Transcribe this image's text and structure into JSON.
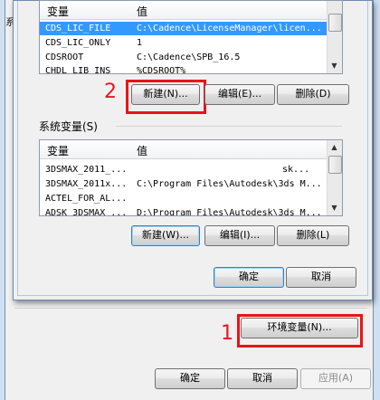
{
  "parent_window": {
    "tab_fragment": "系",
    "env_vars_button": "环境变量(N)...",
    "ok_button": "确定",
    "cancel_button": "取消",
    "apply_button": "应用(A)"
  },
  "user_vars": {
    "header": {
      "name_col": "变量",
      "value_col": "值"
    },
    "rows": [
      {
        "name": "CDS_LIC_FILE",
        "value": "C:\\Cadence\\LicenseManager\\licen...",
        "selected": true
      },
      {
        "name": "CDS_LIC_ONLY",
        "value": "1",
        "selected": false
      },
      {
        "name": "CDSROOT",
        "value": "C:\\Cadence\\SPB_16.5",
        "selected": false
      },
      {
        "name": "CHDL_LIB_INS",
        "value": "%CDSROOT%",
        "selected": false
      }
    ],
    "buttons": {
      "new": "新建(N)...",
      "edit": "编辑(E)...",
      "delete": "删除(D)"
    }
  },
  "system_vars": {
    "label": "系统变量(S)",
    "header": {
      "name_col": "变量",
      "value_col": "值"
    },
    "rows": [
      {
        "name": "3DSMAX_2011_...",
        "value": "sk..."
      },
      {
        "name": "3DSMAX_2011x...",
        "value": "C:\\Program Files\\Autodesk\\3ds M..."
      },
      {
        "name": "ACTEL_FOR_AL...",
        "value": ""
      },
      {
        "name": "ADSK_3DSMAX_...",
        "value": "D:\\Program Files\\Autodesk\\3ds M..."
      }
    ],
    "buttons": {
      "new": "新建(W)...",
      "edit": "编辑(I)...",
      "delete": "删除(L)"
    }
  },
  "dialog_buttons": {
    "ok": "确定",
    "cancel": "取消"
  },
  "annotations": {
    "step1": "1",
    "step2": "2"
  },
  "colors": {
    "annotation_red": "#e8141a",
    "selection_blue": "#3399ff"
  }
}
